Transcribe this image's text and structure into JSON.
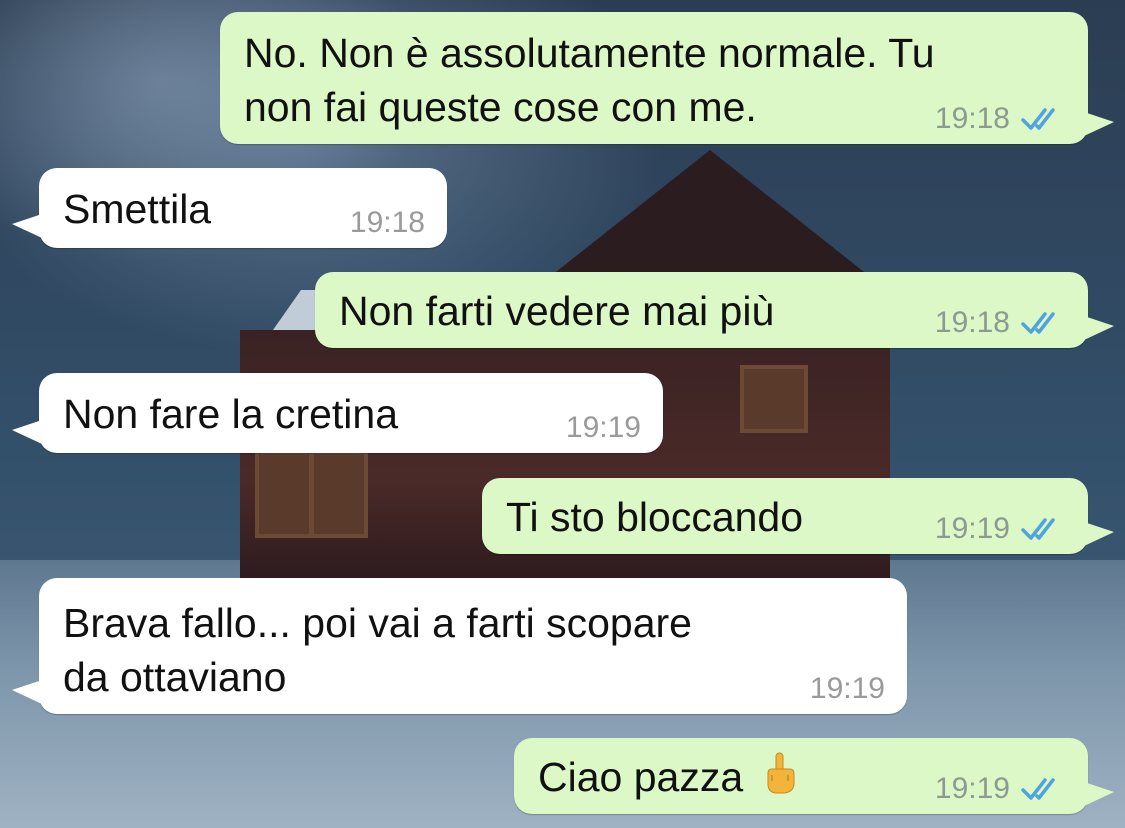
{
  "messages": [
    {
      "id": "m1",
      "direction": "out",
      "text_line1": "No. Non è assolutamente normale. Tu",
      "text_line2": "non fai queste cose con me.",
      "time": "19:18",
      "status": "read"
    },
    {
      "id": "m2",
      "direction": "in",
      "text": "Smettila",
      "time": "19:18"
    },
    {
      "id": "m3",
      "direction": "out",
      "text": "Non farti vedere mai più",
      "time": "19:18",
      "status": "read"
    },
    {
      "id": "m4",
      "direction": "in",
      "text": "Non fare la cretina",
      "time": "19:19"
    },
    {
      "id": "m5",
      "direction": "out",
      "text": "Ti sto bloccando",
      "time": "19:19",
      "status": "read"
    },
    {
      "id": "m6",
      "direction": "in",
      "text_line1": "Brava fallo... poi vai a farti scopare",
      "text_line2": "da ottaviano",
      "time": "19:19"
    },
    {
      "id": "m7",
      "direction": "out",
      "text": "Ciao pazza",
      "emoji": "middle-finger-emoji",
      "time": "19:19",
      "status": "read"
    }
  ],
  "colors": {
    "outgoing_bubble": "#dcf8c6",
    "incoming_bubble": "#ffffff",
    "read_ticks": "#4fa3e0",
    "timestamp": "#8d9a90"
  },
  "icons": {
    "read_receipt": "double-check-icon"
  }
}
